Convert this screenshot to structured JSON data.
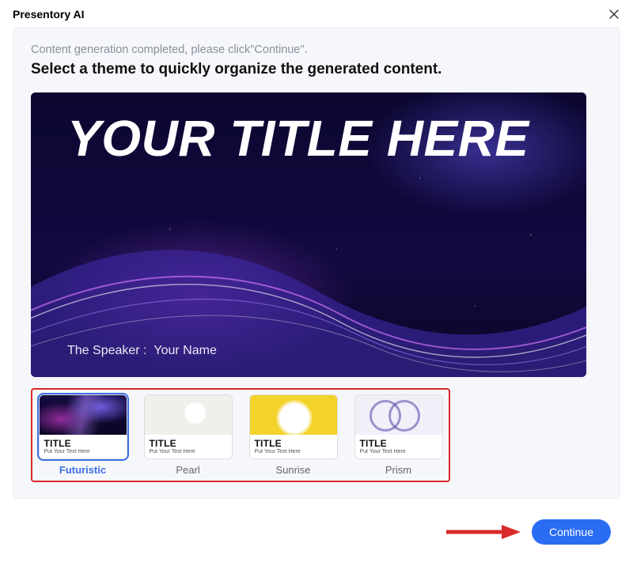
{
  "header": {
    "app_title": "Presentory AI"
  },
  "panel": {
    "status_line": "Content generation completed, please click\"Continue\".",
    "instruction": "Select a theme to quickly organize the generated content.",
    "preview": {
      "title": "YOUR TITLE HERE",
      "speaker_label": "The Speaker :",
      "speaker_name": "Your Name"
    },
    "thumb_caption_title": "TITLE",
    "thumb_caption_sub": "Put Your Text Here",
    "themes": [
      {
        "name": "Futuristic",
        "selected": true
      },
      {
        "name": "Pearl",
        "selected": false
      },
      {
        "name": "Sunrise",
        "selected": false
      },
      {
        "name": "Prism",
        "selected": false
      }
    ]
  },
  "footer": {
    "continue_label": "Continue"
  },
  "colors": {
    "accent": "#2a6df4",
    "annotation_red": "#d92a2a"
  }
}
